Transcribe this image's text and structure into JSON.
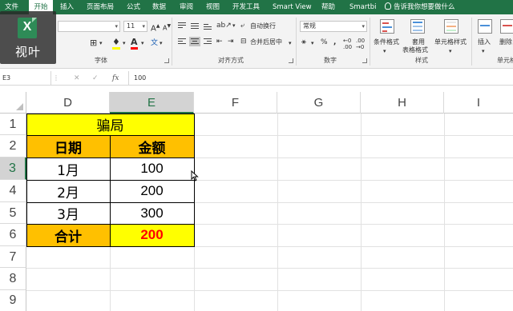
{
  "menu": {
    "tabs": [
      "文件",
      "开始",
      "插入",
      "页面布局",
      "公式",
      "数据",
      "审阅",
      "视图",
      "开发工具",
      "Smart View",
      "帮助",
      "Smartbi"
    ],
    "active": "开始",
    "tell_me": "告诉我你想要做什么"
  },
  "logo": {
    "name": "视叶"
  },
  "ribbon": {
    "font_size": "11",
    "wrap_text": "自动换行",
    "merge_center": "合并后居中",
    "number_format": "常规",
    "percent": "%",
    "comma": ",",
    "cond_format": "条件格式",
    "table_format_1": "套用",
    "table_format_2": "表格格式",
    "cell_styles": "单元格样式",
    "insert": "插入",
    "delete": "删除",
    "groups": {
      "font": "字体",
      "alignment": "对齐方式",
      "number": "数字",
      "styles": "样式",
      "cells": "单元格"
    }
  },
  "formula_bar": {
    "cell_ref": "E3",
    "fx": "fx",
    "value": "100"
  },
  "grid": {
    "columns": [
      "D",
      "E",
      "F",
      "G",
      "H",
      "I"
    ],
    "selected_column": "E",
    "rows": [
      "1",
      "2",
      "3",
      "4",
      "5",
      "6",
      "7",
      "8",
      "9"
    ],
    "selected_row": "3"
  },
  "table": {
    "title": "骗局",
    "header": {
      "date": "日期",
      "amount": "金额"
    },
    "rows": [
      {
        "date": "1月",
        "amount": "100"
      },
      {
        "date": "2月",
        "amount": "200"
      },
      {
        "date": "3月",
        "amount": "300"
      }
    ],
    "total": {
      "label": "合计",
      "value": "200"
    }
  },
  "colors": {
    "accent": "#217346",
    "header_fill": "#ffc000",
    "title_fill": "#ffff00",
    "total_value": "#ff0000"
  }
}
